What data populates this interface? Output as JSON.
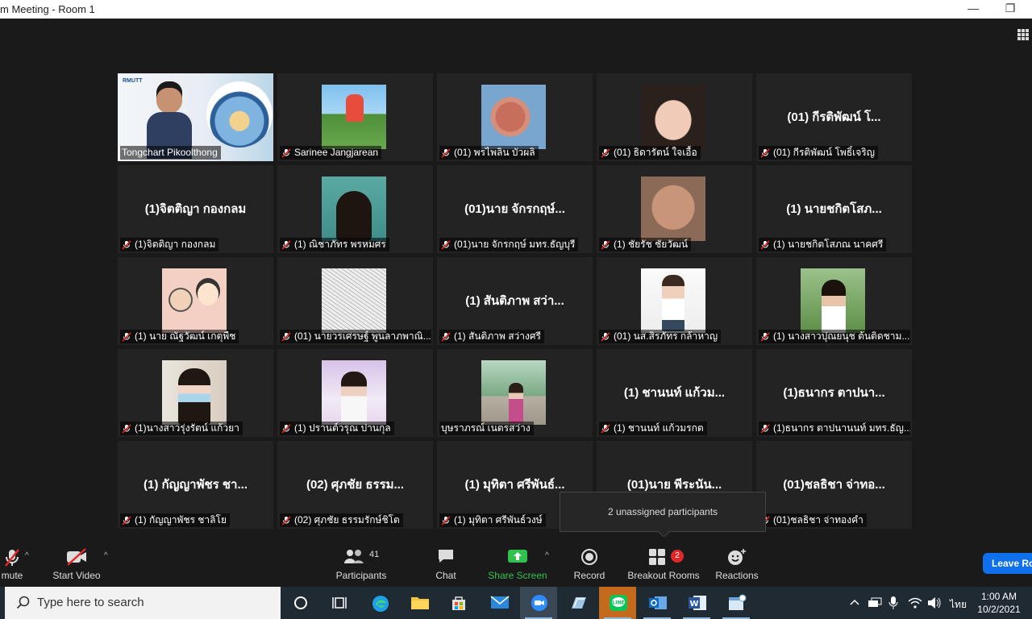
{
  "window": {
    "title": "m Meeting - Room 1",
    "minimize_glyph": "—",
    "restore_glyph": "❐"
  },
  "participants_grid": [
    {
      "name": "Tongchart Pikoolthong",
      "display": "",
      "muted": false,
      "video": "host",
      "active": true,
      "logo_text": "RMUTT"
    },
    {
      "name": "Sarinee Jangjarean",
      "display": "",
      "muted": true,
      "video": "boy"
    },
    {
      "name": "(01) พรไพลิน บัวผลิ",
      "display": "",
      "muted": true,
      "video": "pink"
    },
    {
      "name": "(01) ธิดารัตน์ ใจเอื้อ",
      "display": "",
      "muted": true,
      "video": "girl1"
    },
    {
      "name": "(01) กีรติพัฒน์ โพธิ์เจริญ",
      "display": "(01) กีรติพัฒน์ โ...",
      "muted": true,
      "video": ""
    },
    {
      "name": "(1)จิตติญา กองกลม",
      "display": "(1)จิตติญา กองกลม",
      "muted": true,
      "video": ""
    },
    {
      "name": "(1) ณิชาภัทร พรหมศร",
      "display": "",
      "muted": true,
      "video": "girl2"
    },
    {
      "name": "(01)นาย จักรกฤษ์ มทร.ธัญบุรี",
      "display": "(01)นาย จักรกฤษ์...",
      "muted": true,
      "video": ""
    },
    {
      "name": "(1) ชัยรัช ชัยวัฒน์",
      "display": "",
      "muted": true,
      "video": "man"
    },
    {
      "name": "(1) นายชกิตโสภณ นาคศรี",
      "display": "(1) นายชกิตโสภ...",
      "muted": true,
      "video": ""
    },
    {
      "name": "(1) นาย ณัฐวัฒน์ เกตุพืช",
      "display": "",
      "muted": true,
      "video": "cartoon"
    },
    {
      "name": "(01) นายวรเศรษฐ์ พูนลาภพาณิ...",
      "display": "",
      "muted": true,
      "video": "sketch"
    },
    {
      "name": "(1) สันติภาพ สว่างศรี",
      "display": "(1) สันติภาพ สว่า...",
      "muted": true,
      "video": ""
    },
    {
      "name": "(01) นส.สิรภัทร กล้าหาญ",
      "display": "",
      "muted": true,
      "video": "student"
    },
    {
      "name": "(1) นางสาวปุณยนุช ต้นติดชาม...",
      "display": "",
      "muted": true,
      "video": "outdoor"
    },
    {
      "name": "(1)นางสาวรุ่งรัตน์ แก้วยา",
      "display": "",
      "muted": true,
      "video": "mask"
    },
    {
      "name": "(1) ปรานต์วรุณ ปานกุล",
      "display": "",
      "muted": true,
      "video": "pinkroom"
    },
    {
      "name": "บุษราภรณ์ เนตรสว่าง",
      "display": "",
      "muted": false,
      "video": "palms"
    },
    {
      "name": "(1) ชานนท์ แก้วมรกต",
      "display": "(1) ชานนท์ แก้วม...",
      "muted": true,
      "video": ""
    },
    {
      "name": "(1)ธนากร ตาปนานนท์ มทร.ธัญ...",
      "display": "(1)ธนากร ตาปนา...",
      "muted": true,
      "video": ""
    },
    {
      "name": "(1) กัญญาพัชร ชาลิโย",
      "display": "(1) กัญญาพัชร ชา...",
      "muted": true,
      "video": ""
    },
    {
      "name": "(02) ศุภชัย ธรรมรักษ์ชิโต",
      "display": "(02) ศุภชัย ธรรม...",
      "muted": true,
      "video": ""
    },
    {
      "name": "(1) มุทิตา ศรีพันธ์วงษ์",
      "display": "(1) มุทิตา ศรีพันธ์...",
      "muted": true,
      "video": ""
    },
    {
      "name": "(01)นาย พีระนันท์",
      "display": "(01)นาย พีระนัน...",
      "muted": true,
      "video": "",
      "hidden_label": true
    },
    {
      "name": "(01)ชลธิชา จ่าทองคำ",
      "display": "(01)ชลธิชา จ่าทอ...",
      "muted": true,
      "video": ""
    }
  ],
  "tooltip": {
    "text": "2 unassigned participants"
  },
  "toolbar": {
    "mute_label": "mute",
    "video_label": "Start Video",
    "participants_label": "Participants",
    "participants_count": "41",
    "chat_label": "Chat",
    "share_label": "Share Screen",
    "record_label": "Record",
    "breakout_label": "Breakout Rooms",
    "breakout_badge": "2",
    "reactions_label": "Reactions",
    "leave_label": "Leave Ro",
    "caret": "^"
  },
  "taskbar": {
    "search_placeholder": "Type here to search",
    "language": "ไทย",
    "time": "1:00 AM",
    "date": "10/2/2021"
  },
  "colors": {
    "active_speaker_border": "#e6e673",
    "share_green": "#31c24d",
    "leave_blue": "#0e71eb",
    "badge_red": "#e02828",
    "mic_off_red": "#e02828"
  }
}
